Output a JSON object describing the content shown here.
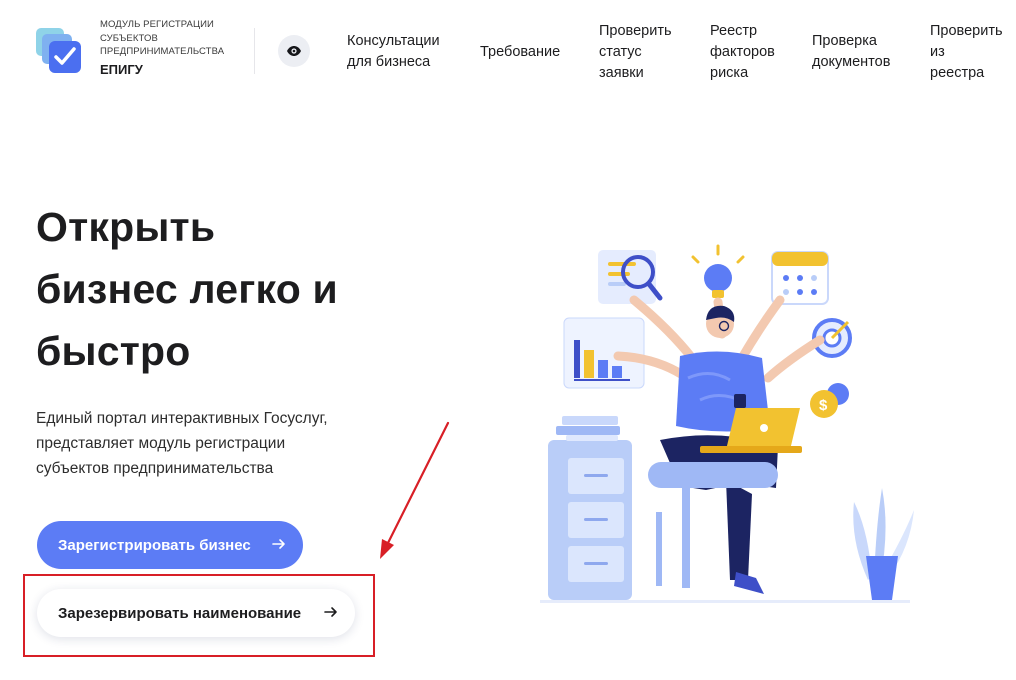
{
  "header": {
    "logo_small_lines": [
      "МОДУЛЬ РЕГИСТРАЦИИ",
      "СУБЪЕКТОВ",
      "ПРЕДПРИНИМАТЕЛЬСТВА"
    ],
    "logo_name": "ЕПИГУ",
    "nav": [
      {
        "lines": [
          "Консультации",
          "для бизнеса"
        ]
      },
      {
        "lines": [
          "Требование"
        ]
      },
      {
        "lines": [
          "Проверить",
          "статус",
          "заявки"
        ]
      },
      {
        "lines": [
          "Реестр",
          "факторов",
          "риска"
        ]
      },
      {
        "lines": [
          "Проверка",
          "документов"
        ]
      },
      {
        "lines": [
          "Проверить",
          "из",
          "реестра"
        ]
      }
    ]
  },
  "hero": {
    "title_lines": [
      "Открыть",
      "бизнес легко и",
      "быстро"
    ],
    "description_lines": [
      "Единый портал интерактивных Госуслуг,",
      "представляет модуль регистрации",
      "субъектов предпринимательства"
    ],
    "primary_button": "Зарегистрировать бизнес",
    "secondary_button": "Зарезервировать наименование"
  },
  "icons": {
    "logo": "checkmark-stack-logo-icon",
    "accessibility": "eye-icon",
    "button_arrow": "arrow-right-icon"
  },
  "colors": {
    "primary": "#5c7cf5",
    "annotation": "#d81f26",
    "text": "#1d1d1f"
  }
}
